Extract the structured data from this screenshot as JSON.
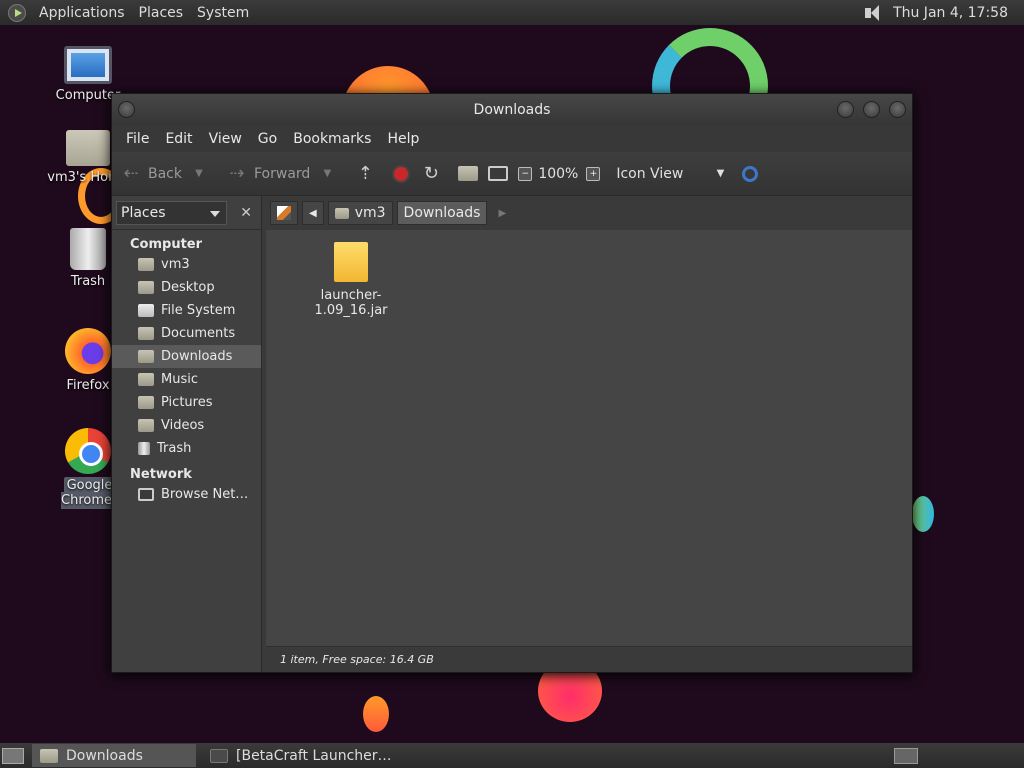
{
  "top_panel": {
    "menus": [
      "Applications",
      "Places",
      "System"
    ],
    "clock": "Thu Jan  4, 17:58"
  },
  "desktop": {
    "icons": [
      {
        "label": "Computer",
        "icon": "computer-icon"
      },
      {
        "label": "vm3's Home",
        "icon": "home-folder-icon"
      },
      {
        "label": "Trash",
        "icon": "trash-icon"
      },
      {
        "label": "Firefox",
        "icon": "firefox-icon"
      },
      {
        "label": "Google Chrome",
        "icon": "chrome-icon"
      }
    ]
  },
  "window": {
    "title": "Downloads",
    "menu": [
      "File",
      "Edit",
      "View",
      "Go",
      "Bookmarks",
      "Help"
    ],
    "toolbar": {
      "back": "Back",
      "forward": "Forward",
      "zoom": "100%",
      "view_mode": "Icon View"
    },
    "sidebar": {
      "selector": "Places",
      "groups": [
        {
          "title": "Computer",
          "items": [
            "vm3",
            "Desktop",
            "File System",
            "Documents",
            "Downloads",
            "Music",
            "Pictures",
            "Videos",
            "Trash"
          ]
        },
        {
          "title": "Network",
          "items": [
            "Browse Net…"
          ]
        }
      ],
      "selected": "Downloads"
    },
    "pathbar": [
      "vm3",
      "Downloads"
    ],
    "files": [
      {
        "name": "launcher-1.09_16.jar",
        "icon": "jar-file-icon"
      }
    ],
    "status": "1 item, Free space: 16.4 GB"
  },
  "bottom_panel": {
    "tasks": [
      "Downloads",
      "[BetaCraft Launcher…"
    ]
  }
}
